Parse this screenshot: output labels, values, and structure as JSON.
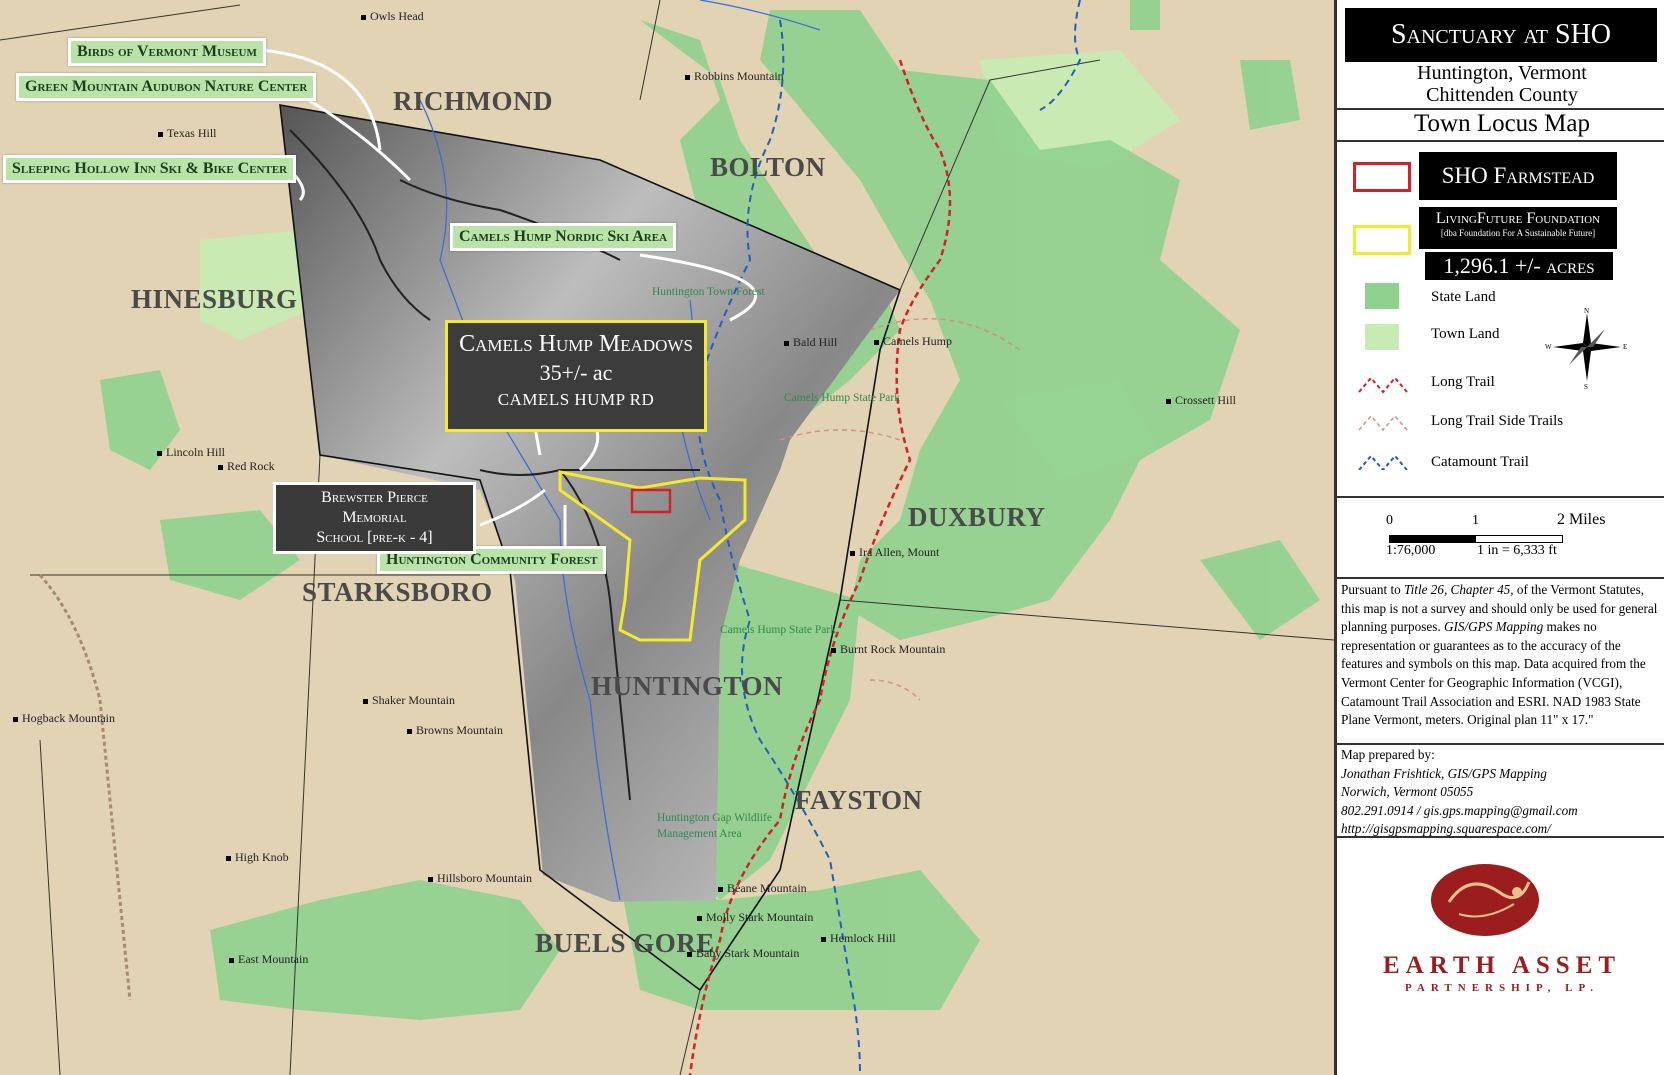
{
  "header": {
    "title": "Sanctuary at SHO",
    "location_line1": "Huntington, Vermont",
    "location_line2": "Chittenden County",
    "map_type": "Town Locus Map"
  },
  "legend": {
    "sho_farmstead": {
      "label": "SHO Farmstead",
      "color": "#d42027"
    },
    "livingfuture": {
      "label": "LivingFuture Foundation",
      "dba": "[dba Foundation For A Sustainable Future]",
      "acres": "1,296.1 +/- acres",
      "color": "#f2ea2a"
    },
    "state_land": {
      "label": "State Land",
      "color": "#8fd18f"
    },
    "town_land": {
      "label": "Town Land",
      "color": "#c6ecb3"
    },
    "long_trail": {
      "label": "Long Trail",
      "color": "#d42027"
    },
    "side_trails": {
      "label": "Long Trail Side Trails",
      "color": "#d88a8a"
    },
    "catamount": {
      "label": "Catamount Trail",
      "color": "#1f5fbf"
    },
    "compass": {
      "n": "N",
      "s": "S",
      "e": "E",
      "w": "W"
    }
  },
  "scale": {
    "tick0": "0",
    "tick1": "1",
    "tick2": "2 Miles",
    "ratio": "1:76,000",
    "inch": "1 in = 6,333 ft"
  },
  "disclaimer": {
    "p1": "Pursuant to ",
    "p1_ital": "Title 26, Chapter 45,",
    "p2": " of the Vermont Statutes, this map is not a survey and should only be used for general planning purposes. ",
    "p2_ital": "GIS/GPS Mapping",
    "p3": " makes no representation or guarantees as to the accuracy of the features and symbols on this map. Data acquired from the Vermont Center for Geographic Information (VCGI), Catamount Trail Association and ESRI. NAD 1983 State Plane Vermont, meters.  Original plan 11\" x 17.\""
  },
  "prepared": {
    "heading": "Map prepared by:",
    "name": "Jonathan Frishtick, GIS/GPS Mapping",
    "city": "Norwich, Vermont  05055",
    "contact": "802.291.0914  /  gis.gps.mapping@gmail.com",
    "url": "http://gisgpsmapping.squarespace.com/"
  },
  "logo": {
    "name": "EARTH ASSET",
    "sub": "PARTNERSHIP, LP.",
    "reg": "®"
  },
  "towns": {
    "richmond": "RICHMOND",
    "bolton": "BOLTON",
    "hinesburg": "HINESBURG",
    "duxbury": "DUXBURY",
    "starksboro": "STARKSBORO",
    "huntington": "HUNTINGTON",
    "fayston": "FAYSTON",
    "buels_gore": "BUELS GORE"
  },
  "peaks": {
    "owls_head": "Owls Head",
    "robbins": "Robbins Mountain",
    "texas": "Texas Hill",
    "bald": "Bald Hill",
    "camels": "Camels Hump",
    "crossett": "Crossett Hill",
    "lincoln": "Lincoln Hill",
    "red_rock": "Red Rock",
    "ira_allen": "Ira Allen, Mount",
    "burnt_rock": "Burnt Rock Mountain",
    "shaker": "Shaker Mountain",
    "browns": "Browns Mountain",
    "hogback": "Hogback Mountain",
    "high_knob": "High Knob",
    "hillsboro": "Hillsboro Mountain",
    "beane": "Beane Mountain",
    "molly": "Molly Stark Mountain",
    "hemlock": "Hemlock Hill",
    "baby_stark": "Baby Stark Mountain",
    "east": "East Mountain"
  },
  "areas": {
    "town_forest": "Huntington Town Forest",
    "state_park1": "Camels Hump State Park",
    "state_park2": "Camels Hump State Park",
    "wildlife1": "Huntington Gap Wildlife",
    "wildlife2": "Management Area"
  },
  "callouts": {
    "birds": "Birds of Vermont Museum",
    "audubon": "Green Mountain Audubon Nature Center",
    "sleeping": "Sleeping Hollow Inn Ski & Bike Center",
    "nordic": "Camels Hump Nordic Ski Area",
    "meadows_name": "Camels Hump Meadows",
    "meadows_acres": "35+/- ac",
    "meadows_road": "CAMELS HUMP RD",
    "school1": "Brewster Pierce Memorial",
    "school2": "School [pre-k - 4]",
    "community_forest": "Huntington Community Forest"
  }
}
